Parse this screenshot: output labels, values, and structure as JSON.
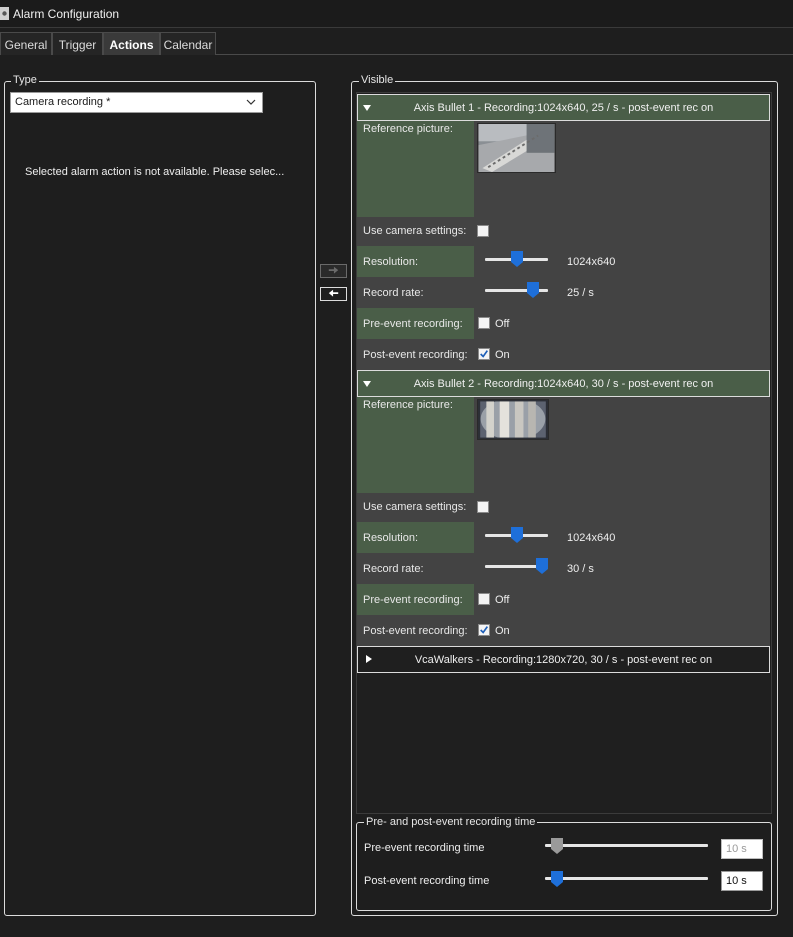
{
  "window": {
    "title": "Alarm Configuration"
  },
  "tabs": [
    {
      "label": "General"
    },
    {
      "label": "Trigger"
    },
    {
      "label": "Actions"
    },
    {
      "label": "Calendar"
    }
  ],
  "active_tab": "Actions",
  "type_panel": {
    "title": "Type",
    "selected_value": "Camera recording *",
    "message": "Selected alarm action is not available. Please selec..."
  },
  "visible_panel": {
    "title": "Visible",
    "cameras": [
      {
        "header": "Axis Bullet 1 - Recording:1024x640, 25 / s - post-event rec on",
        "expanded": true,
        "reference_label": "Reference picture:",
        "use_camera_settings_label": "Use camera settings:",
        "use_camera_settings": false,
        "resolution_label": "Resolution:",
        "resolution_value": "1024x640",
        "resolution_level": 0.5,
        "record_rate_label": "Record rate:",
        "record_rate_value": "25 / s",
        "record_rate_level": 0.76,
        "pre_event_label": "Pre-event recording:",
        "pre_event_checked": false,
        "pre_event_text": "Off",
        "post_event_label": "Post-event recording:",
        "post_event_checked": true,
        "post_event_text": "On"
      },
      {
        "header": "Axis Bullet 2 - Recording:1024x640, 30 / s - post-event rec on",
        "expanded": true,
        "reference_label": "Reference picture:",
        "use_camera_settings_label": "Use camera settings:",
        "use_camera_settings": false,
        "resolution_label": "Resolution:",
        "resolution_value": "1024x640",
        "resolution_level": 0.5,
        "record_rate_label": "Record rate:",
        "record_rate_value": "30 / s",
        "record_rate_level": 0.9,
        "pre_event_label": "Pre-event recording:",
        "pre_event_checked": false,
        "pre_event_text": "Off",
        "post_event_label": "Post-event recording:",
        "post_event_checked": true,
        "post_event_text": "On"
      },
      {
        "header": "VcaWalkers - Recording:1280x720, 30 / s - post-event rec on",
        "expanded": false
      }
    ]
  },
  "recording_time_panel": {
    "title": "Pre- and post-event recording time",
    "pre_label": "Pre-event recording time",
    "pre_value": "10 s",
    "pre_enabled": false,
    "post_label": "Post-event recording time",
    "post_value": "10 s",
    "post_enabled": true
  },
  "icons": {
    "window": "gear-icon",
    "move_right": "arrow-right-icon",
    "move_left": "arrow-left-icon",
    "expand": "triangle-down-icon",
    "collapse": "triangle-right-icon",
    "dropdown": "chevron-down-icon"
  },
  "colors": {
    "background": "#1e1e1e",
    "panel": "#434343",
    "header_green": "#4a5e48",
    "accent_blue": "#1e6fd9",
    "text": "#e6e6e6"
  }
}
